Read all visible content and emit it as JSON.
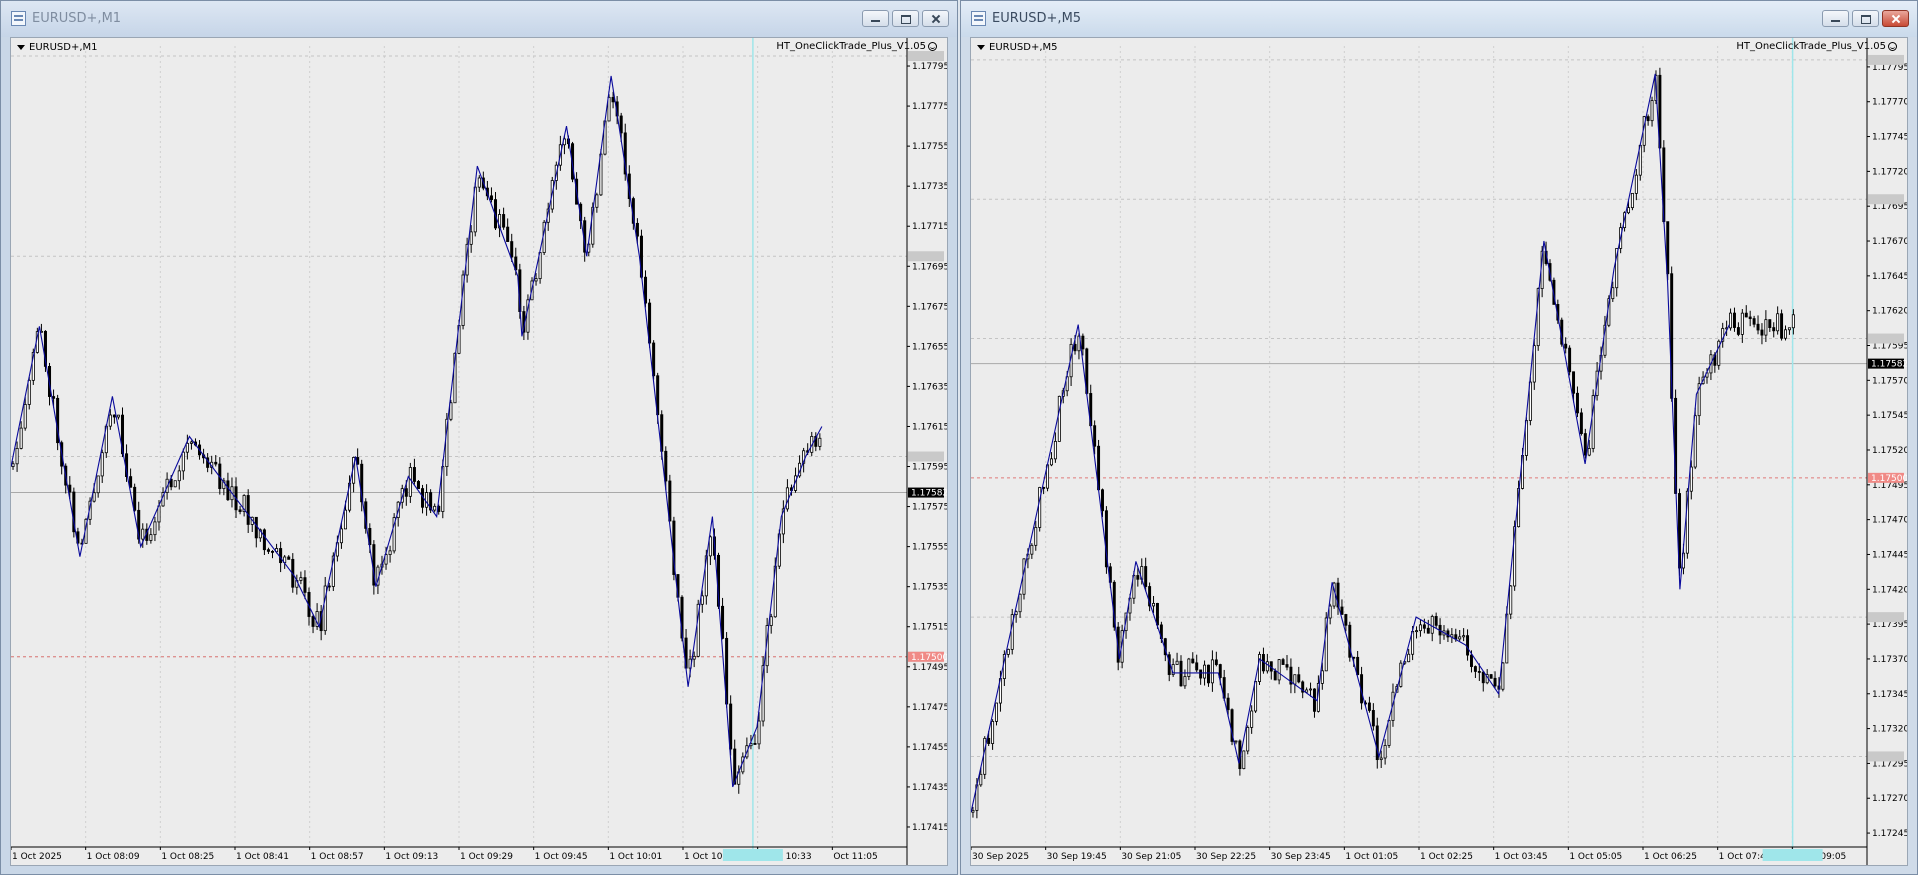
{
  "windows": [
    {
      "title": "EURUSD+,M1",
      "symbol_label": "EURUSD+,M1",
      "indicator_label": "HT_OneClickTrade_Plus_V1.05",
      "colors": {
        "bg": "#ececec",
        "candle": "#000000",
        "zigzag": "#0a0a9c",
        "bid_line": "#a9a9a9",
        "red_line": "#e07a78",
        "cursor": "#9fe6ea"
      }
    },
    {
      "title": "EURUSD+,M5",
      "symbol_label": "EURUSD+,M5",
      "indicator_label": "HT_OneClickTrade_Plus_V1.05",
      "colors": {
        "bg": "#ececec",
        "candle": "#000000",
        "zigzag": "#0a0a9c",
        "bid_line": "#a9a9a9",
        "red_line": "#e07a78",
        "cursor": "#9fe6ea"
      }
    }
  ],
  "chart_data": [
    {
      "type": "candlestick",
      "title": "EURUSD+,M1",
      "ylim": [
        1.17405,
        1.17805
      ],
      "y_ticks": [
        "1.17795",
        "1.17775",
        "1.17755",
        "1.17735",
        "1.17715",
        "1.17695",
        "1.17675",
        "1.17655",
        "1.17635",
        "1.17615",
        "1.17595",
        "1.17575",
        "1.17555",
        "1.17535",
        "1.17515",
        "1.17495",
        "1.17475",
        "1.17455",
        "1.17435",
        "1.17415"
      ],
      "x_ticks": [
        "1 Oct 2025",
        "1 Oct 08:09",
        "1 Oct 08:25",
        "1 Oct 08:41",
        "1 Oct 08:57",
        "1 Oct 09:13",
        "1 Oct 09:29",
        "1 Oct 09:45",
        "1 Oct 10:01",
        "1 Oct 10:17",
        "1 Oct 10:33",
        "Oct 11:05"
      ],
      "price_tags": {
        "current": "1.17582",
        "red": "1.17500"
      },
      "current_price": 1.17582,
      "red_level": 1.175,
      "grey_levels": [
        1.178,
        1.177,
        1.176,
        1.175
      ],
      "cursor_x_fraction": 0.828,
      "zigzag": [
        [
          0,
          1.17595
        ],
        [
          0.035,
          1.17665
        ],
        [
          0.085,
          1.1755
        ],
        [
          0.125,
          1.1763
        ],
        [
          0.16,
          1.17555
        ],
        [
          0.22,
          1.1761
        ],
        [
          0.35,
          1.1754
        ],
        [
          0.38,
          1.17515
        ],
        [
          0.425,
          1.176
        ],
        [
          0.45,
          1.17535
        ],
        [
          0.49,
          1.1759
        ],
        [
          0.525,
          1.1757
        ],
        [
          0.575,
          1.17745
        ],
        [
          0.625,
          1.1769
        ],
        [
          0.63,
          1.1766
        ],
        [
          0.685,
          1.17765
        ],
        [
          0.71,
          1.177
        ],
        [
          0.74,
          1.1779
        ],
        [
          0.775,
          1.177
        ],
        [
          0.835,
          1.17485
        ],
        [
          0.865,
          1.1757
        ],
        [
          0.89,
          1.17435
        ],
        [
          0.92,
          1.17465
        ],
        [
          0.95,
          1.1757
        ],
        [
          0.98,
          1.176
        ],
        [
          1.0,
          1.17615
        ]
      ],
      "candles_seed": 11,
      "candle_count": 200,
      "plot_end_fraction": 0.905
    },
    {
      "type": "candlestick",
      "title": "EURUSD+,M5",
      "ylim": [
        1.17235,
        1.1781
      ],
      "y_ticks": [
        "1.17795",
        "1.17770",
        "1.17745",
        "1.17720",
        "1.17695",
        "1.17670",
        "1.17645",
        "1.17620",
        "1.17595",
        "1.17570",
        "1.17545",
        "1.17520",
        "1.17495",
        "1.17470",
        "1.17445",
        "1.17420",
        "1.17395",
        "1.17370",
        "1.17345",
        "1.17320",
        "1.17295",
        "1.17270",
        "1.17245"
      ],
      "x_ticks": [
        "30 Sep 2025",
        "30 Sep 19:45",
        "30 Sep 21:05",
        "30 Sep 22:25",
        "30 Sep 23:45",
        "1 Oct 01:05",
        "1 Oct 02:25",
        "1 Oct 03:45",
        "1 Oct 05:05",
        "1 Oct 06:25",
        "1 Oct 07:45",
        "1 Oct 09:05"
      ],
      "price_tags": {
        "current": "1.17582",
        "red": "1.17500"
      },
      "current_price": 1.17582,
      "red_level": 1.175,
      "grey_levels": [
        1.178,
        1.177,
        1.176,
        1.174,
        1.173
      ],
      "cursor_x_fraction": 0.917,
      "zigzag": [
        [
          0,
          1.1726
        ],
        [
          0.13,
          1.1761
        ],
        [
          0.18,
          1.1737
        ],
        [
          0.2,
          1.1744
        ],
        [
          0.245,
          1.1736
        ],
        [
          0.3,
          1.1736
        ],
        [
          0.325,
          1.17295
        ],
        [
          0.35,
          1.1737
        ],
        [
          0.42,
          1.1734
        ],
        [
          0.438,
          1.17425
        ],
        [
          0.495,
          1.173
        ],
        [
          0.54,
          1.174
        ],
        [
          0.6,
          1.1738
        ],
        [
          0.64,
          1.17345
        ],
        [
          0.695,
          1.1767
        ],
        [
          0.745,
          1.1751
        ],
        [
          0.78,
          1.1765
        ],
        [
          0.83,
          1.1779
        ],
        [
          0.845,
          1.1764
        ],
        [
          0.86,
          1.1742
        ],
        [
          0.88,
          1.1756
        ],
        [
          0.92,
          1.1761
        ]
      ],
      "candles_seed": 23,
      "candle_count": 210,
      "plot_end_fraction": 0.92
    }
  ]
}
